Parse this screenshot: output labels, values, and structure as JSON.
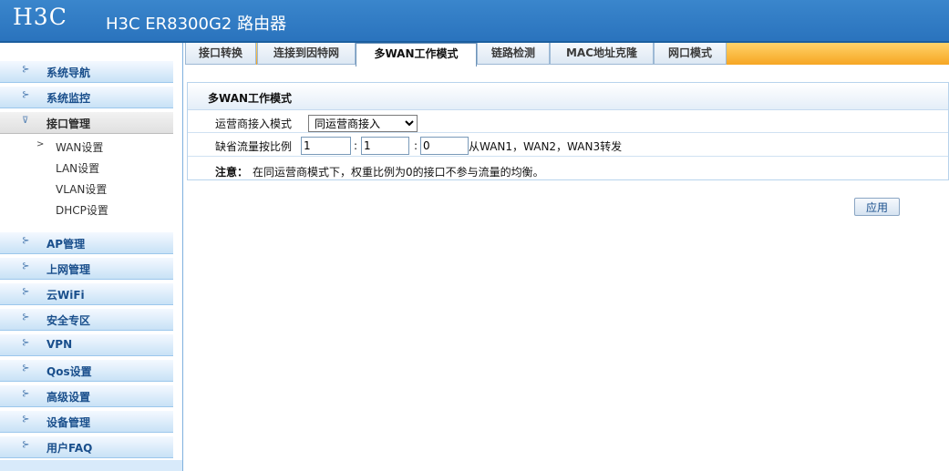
{
  "header": {
    "logo": "H3C",
    "title": "H3C ER8300G2 路由器"
  },
  "sidebar": {
    "items": [
      {
        "label": "系统导航"
      },
      {
        "label": "系统监控"
      },
      {
        "label": "接口管理"
      },
      {
        "label": "AP管理"
      },
      {
        "label": "上网管理"
      },
      {
        "label": "云WiFi"
      },
      {
        "label": "安全专区"
      },
      {
        "label": "VPN"
      },
      {
        "label": "Qos设置"
      },
      {
        "label": "高级设置"
      },
      {
        "label": "设备管理"
      },
      {
        "label": "用户FAQ"
      }
    ],
    "sub_items": [
      {
        "label": "WAN设置"
      },
      {
        "label": "LAN设置"
      },
      {
        "label": "VLAN设置"
      },
      {
        "label": "DHCP设置"
      }
    ]
  },
  "tabs": [
    {
      "label": "接口转换"
    },
    {
      "label": "连接到因特网"
    },
    {
      "label": "多WAN工作模式"
    },
    {
      "label": "链路检测"
    },
    {
      "label": "MAC地址克隆"
    },
    {
      "label": "网口模式"
    }
  ],
  "main": {
    "section_title": "多WAN工作模式",
    "mode_label": "运营商接入模式",
    "mode_value": "同运营商接入",
    "ratio_label": "缺省流量按比例",
    "ratio1": "1",
    "ratio2": "1",
    "ratio3": "0",
    "colon": ":",
    "ratio_suffix": "从WAN1，WAN2，WAN3转发",
    "note_label": "注意：",
    "note_text": "在同运营商模式下，权重比例为0的接口不参与流量的均衡。",
    "apply_label": "应用"
  },
  "colors": {
    "header_bg": "#2b7bc5",
    "tabbar_bg": "#f6a623",
    "menu_text": "#1a4f8c"
  }
}
